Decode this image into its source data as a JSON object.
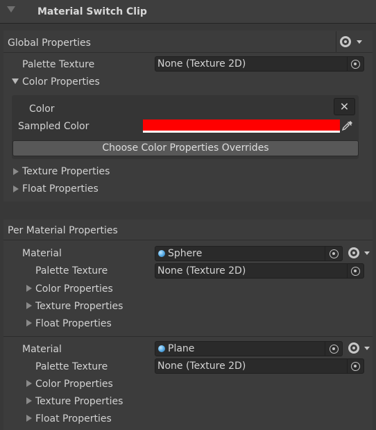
{
  "header": {
    "title": "Material Switch Clip"
  },
  "global": {
    "title": "Global Properties",
    "palette_label": "Palette Texture",
    "palette_value": "None (Texture 2D)",
    "color_props_label": "Color Properties",
    "color_label": "Color",
    "clear_button": "✕",
    "sampled_label": "Sampled Color",
    "sampled_color": "#ff0000",
    "overrides_button": "Choose Color Properties Overrides",
    "texture_props_label": "Texture Properties",
    "float_props_label": "Float Properties"
  },
  "per_material": {
    "title": "Per Material Properties",
    "entries": [
      {
        "material_label": "Material",
        "material_value": "Sphere",
        "palette_label": "Palette Texture",
        "palette_value": "None (Texture 2D)",
        "color_props_label": "Color Properties",
        "texture_props_label": "Texture Properties",
        "float_props_label": "Float Properties"
      },
      {
        "material_label": "Material",
        "material_value": "Plane",
        "palette_label": "Palette Texture",
        "palette_value": "None (Texture 2D)",
        "color_props_label": "Color Properties",
        "texture_props_label": "Texture Properties",
        "float_props_label": "Float Properties"
      }
    ]
  },
  "icons": {
    "header_fold": "triangle-down-icon",
    "settings": "gear-icon",
    "object_picker": "object-picker-icon",
    "eyedropper": "eyedropper-icon",
    "material": "material-sphere-icon"
  }
}
